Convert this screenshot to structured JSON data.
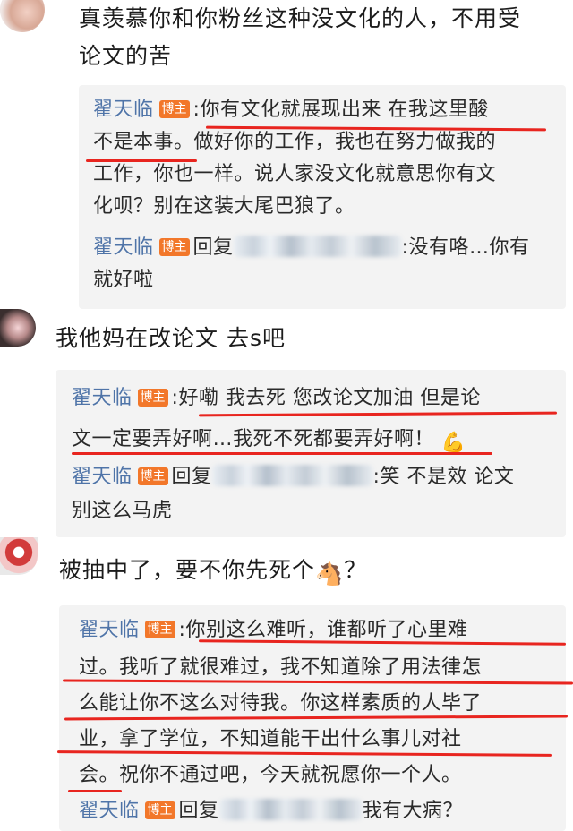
{
  "comments": [
    {
      "text_lines": [
        "真羡慕你和你粉丝这种没文化的人，不用受",
        "论文的苦"
      ],
      "reply": {
        "author": "翟天临",
        "badge": "博主",
        "colon": ":",
        "lines": [
          "你有文化就展现出来 在我这里酸",
          "不是本事。做好你的工作，我也在努力做我的",
          "工作，你也一样。说人家没文化就意思你有文",
          "化呗？别在这装大尾巴狼了。"
        ],
        "sub_author": "翟天临",
        "sub_badge": "博主",
        "sub_prefix": "回复",
        "sub_text_1": ":没有咯…你有",
        "sub_text_2": "就好啦"
      }
    },
    {
      "text_lines": [
        "我他妈在改论文 去s吧"
      ],
      "reply": {
        "author": "翟天临",
        "badge": "博主",
        "colon": ":",
        "lines": [
          "好嘞 我去死 您改论文加油 但是论",
          "文一定要弄好啊…我死不死都要弄好啊！"
        ],
        "emoji": "💪",
        "sub_author": "翟天临",
        "sub_badge": "博主",
        "sub_prefix": "回复",
        "sub_text_1": ":笑 不是效 论文",
        "sub_text_2": "别这么马虎"
      }
    },
    {
      "text_lines": [
        "被抽中了，要不你先死个",
        "？"
      ],
      "emoji": "🐴",
      "reply": {
        "author": "翟天临",
        "badge": "博主",
        "colon": ":",
        "lines": [
          "你别这么难听，谁都听了心里难",
          "过。我听了就很难过，我不知道除了用法律怎",
          "么能让你不这么对待我。你这样素质的人毕了",
          "业，拿了学位，不知道能干出什么事儿对社",
          "会。祝你不通过吧，今天就祝愿你一个人。"
        ],
        "sub_author": "翟天临",
        "sub_badge": "博主",
        "sub_prefix": "回复",
        "sub_text_1": "我有大病？"
      }
    }
  ],
  "colors": {
    "username": "#4f74a8",
    "badge": "#f2772a",
    "underline": "#e8251f",
    "reply_bg": "#f3f3f3"
  }
}
